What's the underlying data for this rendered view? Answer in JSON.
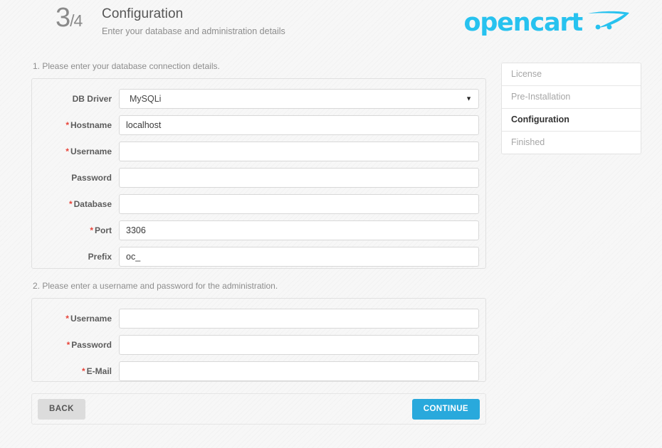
{
  "header": {
    "step_current": "3",
    "step_total": "/4",
    "title": "Configuration",
    "subtitle": "Enter your database and administration details",
    "logo_text": "opencart",
    "logo_icon": "shopping-cart-icon",
    "logo_color": "#27c2ef"
  },
  "sections": {
    "database": {
      "legend": "1. Please enter your database connection details.",
      "fields": [
        {
          "label": "DB Driver",
          "required": false,
          "type": "select",
          "value": "MySQLi",
          "placeholder": ""
        },
        {
          "label": "Hostname",
          "required": true,
          "type": "text",
          "value": "localhost",
          "placeholder": ""
        },
        {
          "label": "Username",
          "required": true,
          "type": "text",
          "value": "",
          "placeholder": ""
        },
        {
          "label": "Password",
          "required": false,
          "type": "text",
          "value": "",
          "placeholder": ""
        },
        {
          "label": "Database",
          "required": true,
          "type": "text",
          "value": "",
          "placeholder": ""
        },
        {
          "label": "Port",
          "required": true,
          "type": "text",
          "value": "3306",
          "placeholder": ""
        },
        {
          "label": "Prefix",
          "required": false,
          "type": "text",
          "value": "oc_",
          "placeholder": ""
        }
      ]
    },
    "administration": {
      "legend": "2. Please enter a username and password for the administration.",
      "fields": [
        {
          "label": "Username",
          "required": true,
          "type": "text",
          "value": "",
          "placeholder": ""
        },
        {
          "label": "Password",
          "required": true,
          "type": "password",
          "value": "",
          "placeholder": ""
        },
        {
          "label": "E-Mail",
          "required": true,
          "type": "text",
          "value": "",
          "placeholder": ""
        }
      ]
    }
  },
  "buttons": {
    "back_label": "BACK",
    "continue_label": "CONTINUE",
    "continue_color": "#29a9dc",
    "back_color": "#dcdcdc"
  },
  "steps_nav": {
    "items": [
      {
        "label": "License",
        "active": false
      },
      {
        "label": "Pre-Installation",
        "active": false
      },
      {
        "label": "Configuration",
        "active": true
      },
      {
        "label": "Finished",
        "active": false
      }
    ]
  },
  "symbols": {
    "required_marker": "*",
    "select_arrow": "▼"
  }
}
